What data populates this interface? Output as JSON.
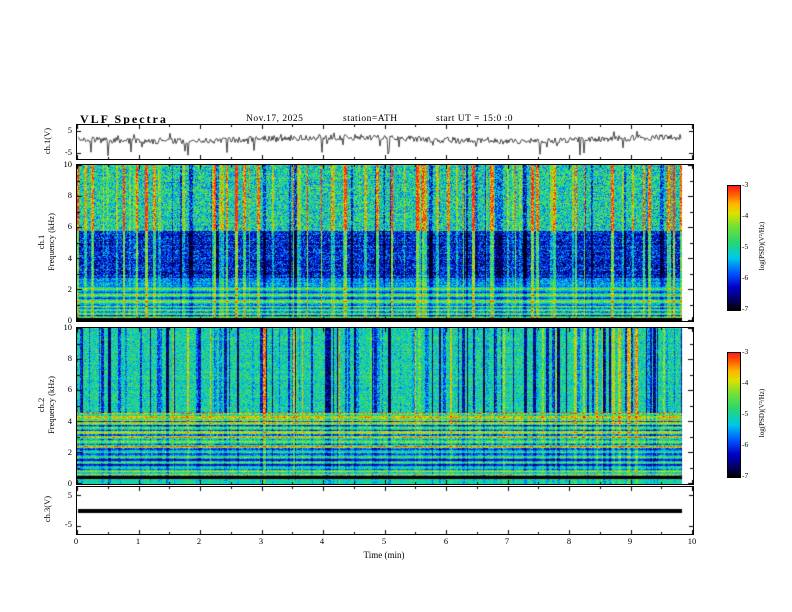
{
  "header": {
    "title": "VLF Spectra",
    "date": "Nov.17, 2025",
    "station": "station=ATH",
    "start_ut": "start UT =  15:0 :0"
  },
  "wave1": {
    "label": "ch.1(V)",
    "ymax": "5",
    "ymin": "-5"
  },
  "spec1": {
    "channel": "ch.1",
    "axis_label": "Frequency (kHz)",
    "yticks": [
      "10",
      "8",
      "6",
      "4",
      "2",
      "0"
    ]
  },
  "spec2": {
    "channel": "ch.2",
    "axis_label": "Frequency (kHz)",
    "yticks": [
      "10",
      "8",
      "6",
      "4",
      "2",
      "0"
    ]
  },
  "wave3": {
    "label": "ch.3(V)",
    "ymax": "5",
    "ymin": "-5"
  },
  "xaxis": {
    "label": "Time (min)",
    "ticks": [
      "0",
      "1",
      "2",
      "3",
      "4",
      "5",
      "6",
      "7",
      "8",
      "9",
      "10"
    ]
  },
  "colorbar": {
    "label": "log(PSD)(V²/Hz)",
    "ticks": [
      "-3",
      "-4",
      "-5",
      "-6",
      "-7"
    ]
  },
  "chart_data": {
    "type": "heatmap",
    "title": "VLF Spectra",
    "date": "Nov.17, 2025",
    "station": "ATH",
    "start_ut": "15:0:0",
    "xlabel": "Time (min)",
    "xlim": [
      0,
      10
    ],
    "x_minutes_recorded": 9.8,
    "zlabel": "log(PSD)(V²/Hz)",
    "zlim": [
      -7,
      -3
    ],
    "colorbar_ticks": [
      -3,
      -4,
      -5,
      -6,
      -7
    ],
    "colormap_stops": [
      [
        0,
        [
          0,
          0,
          0
        ]
      ],
      [
        0.06,
        [
          5,
          0,
          80
        ]
      ],
      [
        0.18,
        [
          0,
          0,
          200
        ]
      ],
      [
        0.3,
        [
          0,
          90,
          255
        ]
      ],
      [
        0.42,
        [
          0,
          200,
          235
        ]
      ],
      [
        0.55,
        [
          40,
          215,
          110
        ]
      ],
      [
        0.68,
        [
          120,
          225,
          50
        ]
      ],
      [
        0.78,
        [
          220,
          225,
          0
        ]
      ],
      [
        0.86,
        [
          255,
          180,
          0
        ]
      ],
      [
        0.93,
        [
          255,
          100,
          0
        ]
      ],
      [
        1,
        [
          255,
          30,
          25
        ]
      ]
    ],
    "panels": [
      {
        "id": "ch1_wave",
        "type": "line",
        "ylabel": "ch.1(V)",
        "ylim": [
          -5,
          5
        ],
        "yticks": [
          5,
          -5
        ],
        "seed": 20251117,
        "summary": "broadband noise around 0 V with frequent impulsive downward spikes toward -5 V (sferics)"
      },
      {
        "id": "ch1_spec",
        "type": "heatmap",
        "ylabel": "Frequency (kHz)",
        "ylim": [
          0,
          10
        ],
        "yticks": [
          0,
          2,
          4,
          6,
          8,
          10
        ],
        "seed": 101,
        "data_frac": 0.982,
        "streaks": {
          "bright_prob": 0.22,
          "bright": [
            0.3,
            2.3
          ],
          "dark_prob": 0.1,
          "dark": [
            -1.2,
            -0.3
          ]
        },
        "bands": [
          {
            "f": [
              0,
              0.25
            ],
            "base": -7.2,
            "noise": 0.15,
            "streak_scale": 0
          },
          {
            "f": [
              0.25,
              1
            ],
            "base": -5.15,
            "noise": 0.45,
            "stripe": [
              0.8,
              0.24,
              1.3
            ],
            "row_noise": 0.25,
            "streak_scale": 0.5
          },
          {
            "f": [
              1,
              2.3
            ],
            "base": -5.1,
            "noise": 0.45,
            "stripe": [
              0.7,
              0.4,
              0.2
            ],
            "row_noise": 0.3,
            "streak_scale": 0.5
          },
          {
            "f": [
              2.3,
              2.8
            ],
            "base": -5.5,
            "noise": 0.55,
            "row_noise": 0.2,
            "streak_scale": 0.7
          },
          {
            "f": [
              2.8,
              5.8
            ],
            "base": -6.15,
            "noise": 0.75,
            "row_noise": 0.2,
            "streak_scale": 0.9
          },
          {
            "f": [
              5.8,
              10.01
            ],
            "base": -5,
            "noise": 0.85,
            "row_noise": 0.1,
            "streak_scale": 1
          }
        ],
        "summary": "green/cyan background with bright yellow-red vertical impulses, dark blue band 3-5.8 kHz, horizontal cyan/green lines 0.3-2.3 kHz, black band at 0-0.25 kHz"
      },
      {
        "id": "ch2_spec",
        "type": "heatmap",
        "ylabel": "Frequency (kHz)",
        "ylim": [
          0,
          10
        ],
        "yticks": [
          0,
          2,
          4,
          6,
          8,
          10
        ],
        "seed": 202,
        "data_frac": 0.982,
        "streaks": {
          "bright_prob": 0.1,
          "bright": [
            0.3,
            1.6
          ],
          "dark_prob": 0.3,
          "dark": [
            -1.7,
            -0.3
          ]
        },
        "bands": [
          {
            "f": [
              0,
              0.35
            ],
            "base": -5,
            "noise": 0.4,
            "streak_scale": 0.3
          },
          {
            "f": [
              0.35,
              0.55
            ],
            "base": -7.1,
            "noise": 0.15,
            "streak_scale": 0
          },
          {
            "f": [
              0.55,
              0.95
            ],
            "base": -4.6,
            "noise": 0.5,
            "stripe": [
              0.7,
              0.2,
              0
            ],
            "row_noise": 0.3,
            "streak_scale": 0.3
          },
          {
            "f": [
              0.95,
              2.3
            ],
            "base": -5.35,
            "noise": 0.4,
            "stripe": [
              0.75,
              0.34,
              0.5
            ],
            "row_noise": 0.3,
            "streak_scale": 0.4
          },
          {
            "f": [
              2.3,
              4.1
            ],
            "base": -4.75,
            "noise": 0.5,
            "stripe": [
              1,
              0.3,
              0.9
            ],
            "row_noise": 0.45,
            "streak_scale": 0.4
          },
          {
            "f": [
              4.1,
              4.6
            ],
            "base": -4.15,
            "noise": 0.6,
            "stripe": [
              0.7,
              0.25,
              0
            ],
            "row_noise": 0.3,
            "streak_scale": 0.5
          },
          {
            "f": [
              4.6,
              10.01
            ],
            "base": -5,
            "noise": 0.6,
            "row_noise": 0.1,
            "streak_scale": 1
          }
        ],
        "summary": "green background with dark blue vertical streaks above 4.6 kHz, strong yellow/orange/red horizontal banding 2.3-4.6 kHz, cyan/green striping 0.55-2.3 kHz, black line at 0.35-0.55 kHz"
      },
      {
        "id": "ch3_wave",
        "type": "line",
        "ylabel": "ch.3(V)",
        "ylim": [
          -5,
          5
        ],
        "yticks": [
          5,
          -5
        ],
        "seed": 3,
        "summary": "constant 0 V flat thick line (no signal on channel 3)"
      }
    ]
  }
}
